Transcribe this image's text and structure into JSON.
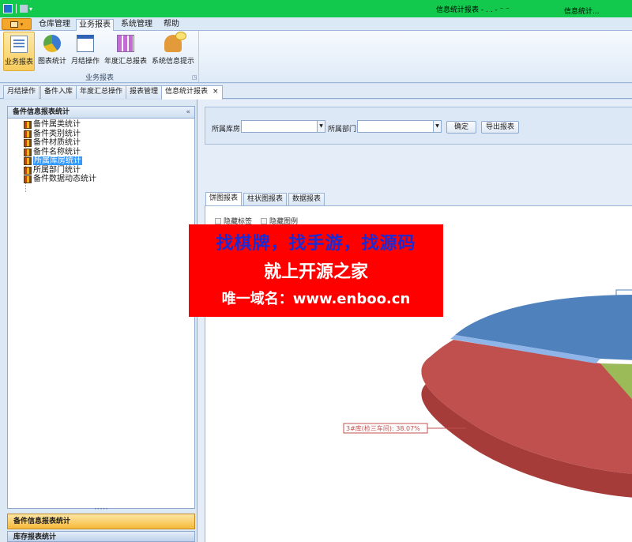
{
  "titlebar": {
    "title": "信息统计报表 - . . - ⁻ ⁻",
    "title_right": "信息统计..."
  },
  "ribbon": {
    "tabs": [
      "仓库管理",
      "业务报表",
      "系统管理",
      "帮助"
    ],
    "active_tab": "业务报表",
    "group_label": "业务报表",
    "buttons": [
      {
        "label": "业务报表",
        "icon": "report-doc-icon"
      },
      {
        "label": "图表统计",
        "icon": "pie-chart-icon"
      },
      {
        "label": "月结操作",
        "icon": "calendar-icon"
      },
      {
        "label": "年度汇总报表",
        "icon": "grid-report-icon"
      },
      {
        "label": "系统信息提示",
        "icon": "user-message-icon"
      }
    ]
  },
  "doc_tabs": [
    "月结操作",
    "备件入库",
    "年度汇总操作",
    "报表管理",
    "信息统计报表"
  ],
  "doc_tab_close": "×",
  "left_panel": {
    "title": "备件信息报表统计",
    "collapse": "«",
    "tree": [
      "备件属类统计",
      "备件类别统计",
      "备件材质统计",
      "备件名称统计",
      "所属库房统计",
      "所属部门统计",
      "备件数据动态统计"
    ],
    "selected_index": 4,
    "splitter": "•••••",
    "nav_active": "备件信息报表统计",
    "nav_next": "库存报表统计"
  },
  "filters": {
    "warehouse_label": "所属库房",
    "warehouse_value": "",
    "dept_label": "所属部门",
    "dept_value": "",
    "confirm_label": "确定",
    "export_label": "导出报表"
  },
  "chart_tabs": [
    "饼图报表",
    "柱状图报表",
    "数据报表"
  ],
  "chart_options": {
    "hide_labels": "隐藏标签",
    "hide_legend": "隐藏图例"
  },
  "chart_data": {
    "type": "pie",
    "slices": [
      {
        "label": "3#库(检三车间)",
        "percent": 38.07,
        "color": "#c0504d"
      },
      {
        "label": "",
        "color": "#4f81bd"
      },
      {
        "label": "",
        "color": "#9bbb59"
      }
    ],
    "label_text": "3#库(检三车间): 38.07%"
  },
  "banner": {
    "line1": "找棋牌，找手游，找源码",
    "line2": "就上开源之家",
    "line3": "唯一域名：www.enboo.cn"
  }
}
